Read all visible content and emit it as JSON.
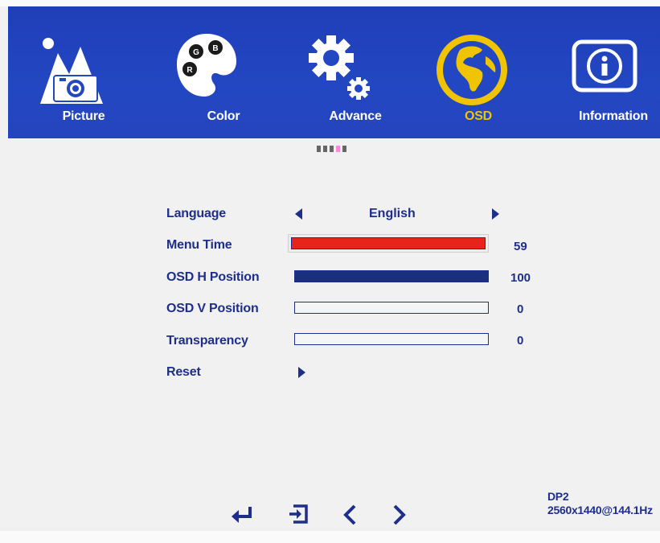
{
  "header": {
    "tabs": [
      {
        "label": "Picture",
        "icon": "picture-icon",
        "active": false
      },
      {
        "label": "Color",
        "icon": "color-palette-icon",
        "active": false
      },
      {
        "label": "Advance",
        "icon": "gears-icon",
        "active": false
      },
      {
        "label": "OSD",
        "icon": "globe-icon",
        "active": true
      },
      {
        "label": "Information",
        "icon": "info-icon",
        "active": false
      }
    ],
    "active_color": "#f0c400",
    "bar_color": "#2346c2"
  },
  "page_indicator": {
    "count": 5,
    "active_index": 3
  },
  "menu": {
    "language": {
      "label": "Language",
      "value": "English"
    },
    "menu_time": {
      "label": "Menu Time",
      "value": "59",
      "level": 1.0,
      "color": "#e8231b"
    },
    "osd_h_position": {
      "label": "OSD H Position",
      "value": "100",
      "level": 1.0,
      "color": "#1b2f80"
    },
    "osd_v_position": {
      "label": "OSD V Position",
      "value": "0",
      "level": 0
    },
    "transparency": {
      "label": "Transparency",
      "value": "0",
      "level": 0
    },
    "reset": {
      "label": "Reset"
    }
  },
  "controls": [
    {
      "name": "enter-icon",
      "glyph": "↵"
    },
    {
      "name": "exit-icon",
      "glyph": "exit"
    },
    {
      "name": "left-icon",
      "glyph": "<"
    },
    {
      "name": "right-icon",
      "glyph": ">"
    }
  ],
  "status": {
    "input": "DP2",
    "mode": "2560x1440@144.1Hz"
  }
}
